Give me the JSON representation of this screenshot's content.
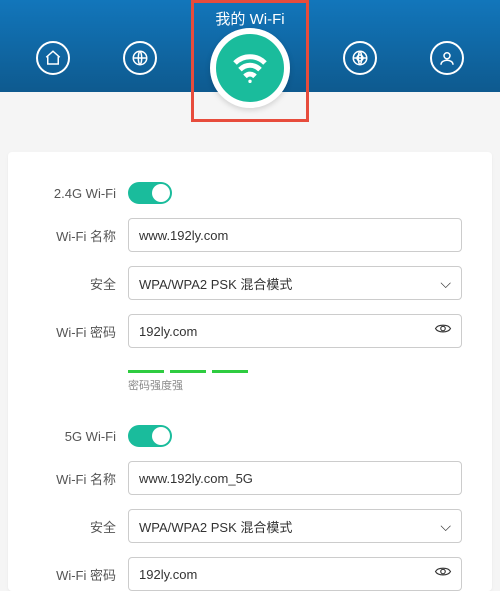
{
  "header": {
    "title": "我的 Wi-Fi"
  },
  "wifi24": {
    "section_label": "2.4G Wi-Fi",
    "name_label": "Wi-Fi 名称",
    "name_value": "www.192ly.com",
    "security_label": "安全",
    "security_value": "WPA/WPA2 PSK 混合模式",
    "password_label": "Wi-Fi 密码",
    "password_value": "192ly.com",
    "strength_text": "密码强度强"
  },
  "wifi5": {
    "section_label": "5G Wi-Fi",
    "name_label": "Wi-Fi 名称",
    "name_value": "www.192ly.com_5G",
    "security_label": "安全",
    "security_value": "WPA/WPA2 PSK 混合模式",
    "password_label": "Wi-Fi 密码",
    "password_value": "192ly.com"
  }
}
